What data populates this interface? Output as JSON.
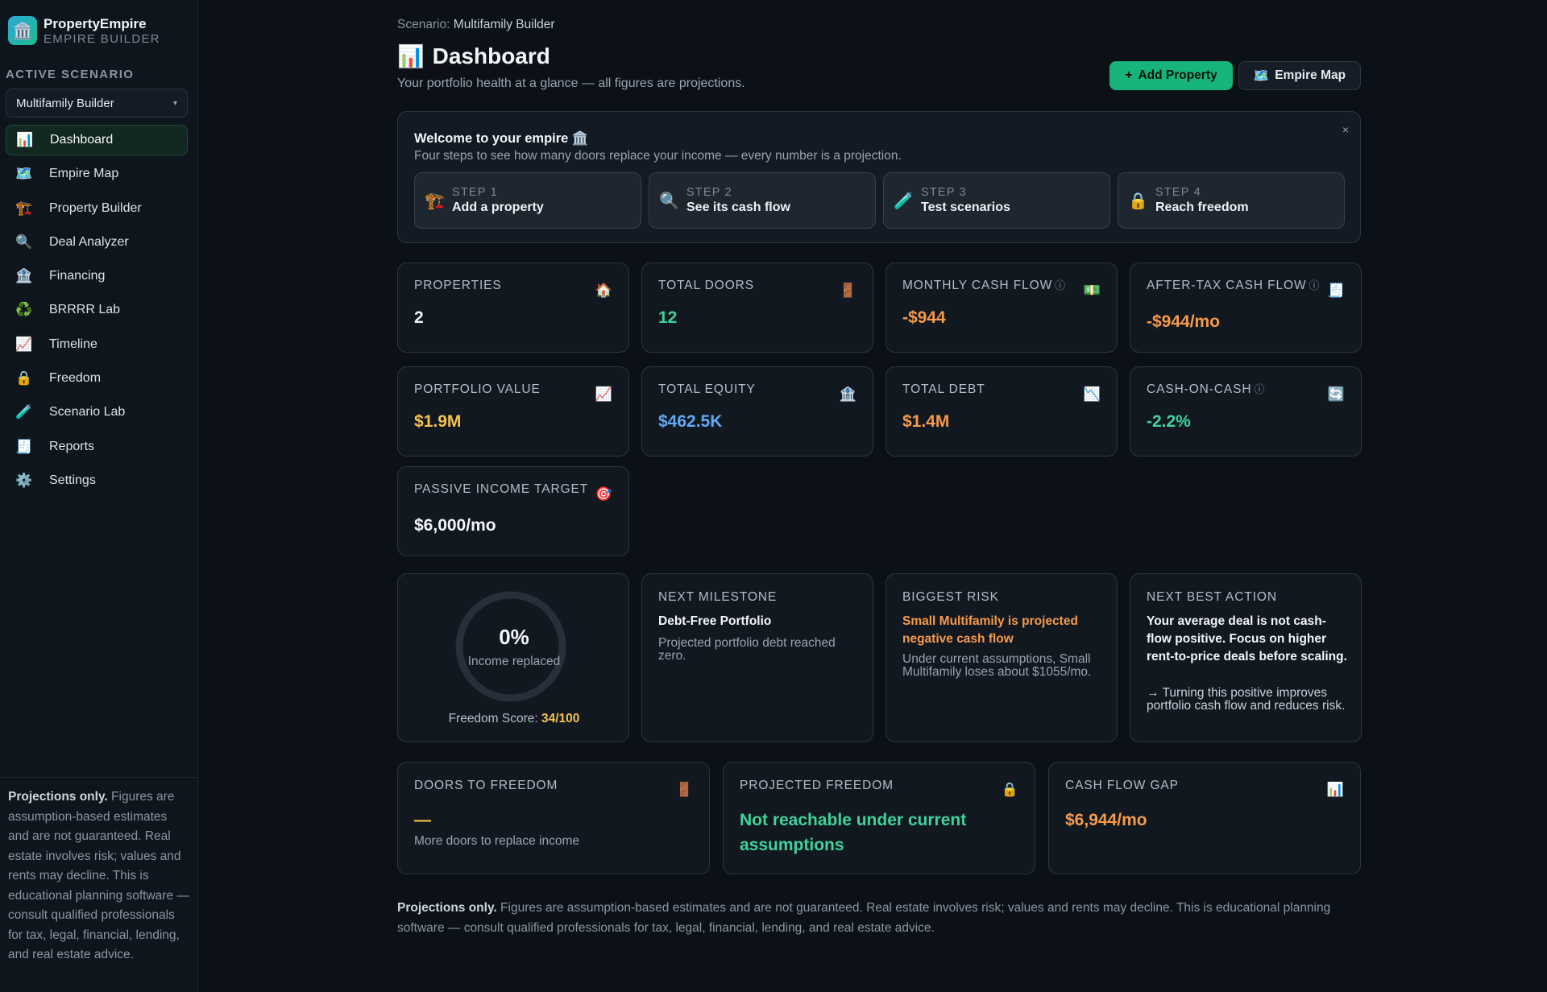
{
  "brand": {
    "name": "PropertyEmpire",
    "subtitle": "EMPIRE BUILDER",
    "logo_icon": "🏛️"
  },
  "sidebar": {
    "active_scenario_label": "ACTIVE SCENARIO",
    "scenario_selected": "Multifamily Builder",
    "items": [
      {
        "icon": "📊",
        "icon_name": "bar-chart-icon",
        "label": "Dashboard",
        "active": true
      },
      {
        "icon": "🗺️",
        "icon_name": "map-icon",
        "label": "Empire Map"
      },
      {
        "icon": "🏗️",
        "icon_name": "crane-icon",
        "label": "Property Builder"
      },
      {
        "icon": "🔍",
        "icon_name": "magnifier-icon",
        "label": "Deal Analyzer"
      },
      {
        "icon": "🏦",
        "icon_name": "bank-icon",
        "label": "Financing"
      },
      {
        "icon": "♻️",
        "icon_name": "recycle-icon",
        "label": "BRRRR Lab"
      },
      {
        "icon": "📈",
        "icon_name": "trend-up-icon",
        "label": "Timeline"
      },
      {
        "icon": "🔒",
        "icon_name": "lock-icon",
        "label": "Freedom"
      },
      {
        "icon": "🧪",
        "icon_name": "test-tube-icon",
        "label": "Scenario Lab"
      },
      {
        "icon": "🧾",
        "icon_name": "receipt-icon",
        "label": "Reports"
      },
      {
        "icon": "⚙️",
        "icon_name": "gear-icon",
        "label": "Settings"
      }
    ],
    "footer_bold": "Projections only.",
    "footer_text": " Figures are assumption-based estimates and are not guaranteed. Real estate involves risk; values and rents may decline. This is educational planning software — consult qualified professionals for tax, legal, financial, lending, and real estate advice."
  },
  "header": {
    "scenario_prefix": "Scenario: ",
    "scenario_name": "Multifamily Builder",
    "title_icon": "📊",
    "title": "Dashboard",
    "subtitle": "Your portfolio health at a glance — all figures are projections.",
    "add_button_icon": "+",
    "add_button": "Add Property",
    "map_button_icon": "🗺️",
    "map_button": "Empire Map"
  },
  "welcome": {
    "title": "Welcome to your empire 🏛️",
    "subtitle": "Four steps to see how many doors replace your income — every number is a projection.",
    "close": "×",
    "steps": [
      {
        "icon": "🏗️",
        "icon_name": "crane-icon",
        "num": "STEP 1",
        "label": "Add a property"
      },
      {
        "icon": "🔍",
        "icon_name": "magnifier-icon",
        "num": "STEP 2",
        "label": "See its cash flow"
      },
      {
        "icon": "🧪",
        "icon_name": "test-tube-icon",
        "num": "STEP 3",
        "label": "Test scenarios"
      },
      {
        "icon": "🔒",
        "icon_name": "lock-icon",
        "num": "STEP 4",
        "label": "Reach freedom"
      }
    ]
  },
  "kpis": [
    {
      "label": "PROPERTIES",
      "info": "",
      "icon": "🏠",
      "icon_name": "house-icon",
      "value": "2",
      "tone": "white"
    },
    {
      "label": "TOTAL DOORS",
      "info": "",
      "icon": "🚪",
      "icon_name": "door-icon",
      "value": "12",
      "tone": "green"
    },
    {
      "label": "MONTHLY CASH FLOW",
      "info": "ⓘ",
      "icon": "💵",
      "icon_name": "money-icon",
      "value": "-$944",
      "tone": "orange"
    },
    {
      "label": "AFTER-TAX CASH FLOW",
      "info": "ⓘ",
      "icon": "🧾",
      "icon_name": "receipt-icon",
      "value": "-$944/mo",
      "tone": "orange"
    },
    {
      "label": "PORTFOLIO VALUE",
      "info": "",
      "icon": "📈",
      "icon_name": "trend-up-icon",
      "value": "$1.9M",
      "tone": "yellow"
    },
    {
      "label": "TOTAL EQUITY",
      "info": "",
      "icon": "🏦",
      "icon_name": "bank-icon",
      "value": "$462.5K",
      "tone": "blue"
    },
    {
      "label": "TOTAL DEBT",
      "info": "",
      "icon": "📉",
      "icon_name": "trend-down-icon",
      "value": "$1.4M",
      "tone": "orange"
    },
    {
      "label": "CASH-ON-CASH",
      "info": "ⓘ",
      "icon": "🔄",
      "icon_name": "cycle-icon",
      "value": "-2.2%",
      "tone": "green"
    },
    {
      "label": "PASSIVE INCOME TARGET",
      "info": "",
      "icon": "🎯",
      "icon_name": "target-icon",
      "value": "$6,000/mo",
      "tone": "white"
    }
  ],
  "freedom_gauge": {
    "percent_text": "0%",
    "percent_value": 0,
    "caption": "Income replaced",
    "score_label": "Freedom Score: ",
    "score_value": "34/100"
  },
  "insights": {
    "milestone": {
      "label": "NEXT MILESTONE",
      "headline": "Debt-Free Portfolio",
      "text": "Projected portfolio debt reached zero."
    },
    "risk": {
      "label": "BIGGEST RISK",
      "headline": "Small Multifamily is projected negative cash flow",
      "text": "Under current assumptions, Small Multifamily loses about $1055/mo."
    },
    "action": {
      "label": "NEXT BEST ACTION",
      "headline": "Your average deal is not cash-flow positive. Focus on higher rent-to-price deals before scaling.",
      "text": "→ Turning this positive improves portfolio cash flow and reduces risk."
    }
  },
  "freedom_cards": [
    {
      "label": "DOORS TO FREEDOM",
      "icon": "🚪",
      "icon_name": "door-icon",
      "value": "—",
      "tone": "yellow",
      "sub": "More doors to replace income"
    },
    {
      "label": "PROJECTED FREEDOM",
      "icon": "🔒",
      "icon_name": "lock-icon",
      "value": "Not reachable under current assumptions",
      "tone": "green",
      "sub": ""
    },
    {
      "label": "CASH FLOW GAP",
      "icon": "📊",
      "icon_name": "bar-chart-icon",
      "value": "$6,944/mo",
      "tone": "orange",
      "sub": ""
    }
  ],
  "footnote": {
    "bold": "Projections only.",
    "text": " Figures are assumption-based estimates and are not guaranteed. Real estate involves risk; values and rents may decline. This is educational planning software — consult qualified professionals for tax, legal, financial, lending, and real estate advice."
  },
  "colors": {
    "accent": "#16b37a",
    "green": "#3fd39a",
    "orange": "#f79a4a",
    "yellow": "#f6c24d",
    "blue": "#63a9f2"
  }
}
